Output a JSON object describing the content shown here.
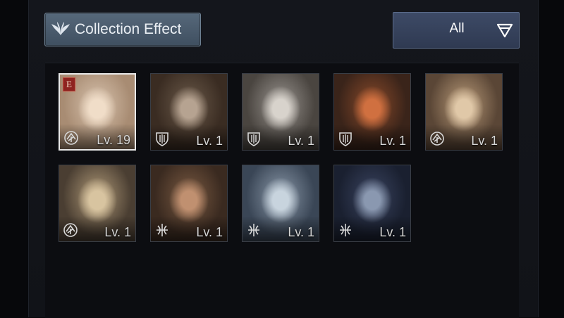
{
  "header": {
    "collection_label": "Collection Effect",
    "collection_icon": "wings-icon",
    "filter_value": "All",
    "filter_icon": "filter-funnel-icon"
  },
  "cards": [
    {
      "name": "blonde-elf-heroine",
      "level": "Lv. 19",
      "class_icon": "sigil-icon",
      "badge": "E",
      "selected": true,
      "colors": [
        "#d8c3ae",
        "#a88c73",
        "#f0ddc8"
      ]
    },
    {
      "name": "bearded-warrior",
      "level": "Lv. 1",
      "class_icon": "shield-icon",
      "colors": [
        "#6b5a4a",
        "#3a2c22",
        "#b6a391"
      ]
    },
    {
      "name": "white-haired-elder",
      "level": "Lv. 1",
      "class_icon": "shield-icon",
      "colors": [
        "#9a9590",
        "#4a4540",
        "#d8d3cc"
      ]
    },
    {
      "name": "red-haired-fighter",
      "level": "Lv. 1",
      "class_icon": "shield-icon",
      "colors": [
        "#8a4a2a",
        "#3a241a",
        "#d07040"
      ]
    },
    {
      "name": "blonde-ponytail-girl",
      "level": "Lv. 1",
      "class_icon": "sigil-icon",
      "colors": [
        "#b89a78",
        "#5a4636",
        "#e0c8a8"
      ]
    },
    {
      "name": "blonde-priestess",
      "level": "Lv. 1",
      "class_icon": "sigil-icon",
      "colors": [
        "#b09a78",
        "#4a3e32",
        "#d8c4a0"
      ]
    },
    {
      "name": "brown-haired-archer",
      "level": "Lv. 1",
      "class_icon": "bow-icon",
      "colors": [
        "#7a5a42",
        "#3a2a20",
        "#c09070"
      ]
    },
    {
      "name": "hooded-blue-archer",
      "level": "Lv. 1",
      "class_icon": "bow-icon",
      "colors": [
        "#8a98a8",
        "#3a4656",
        "#c8d4de"
      ]
    },
    {
      "name": "dark-haired-ranger",
      "level": "Lv. 1",
      "class_icon": "bow-icon",
      "colors": [
        "#3a4460",
        "#1a2030",
        "#8a98b0"
      ]
    }
  ]
}
